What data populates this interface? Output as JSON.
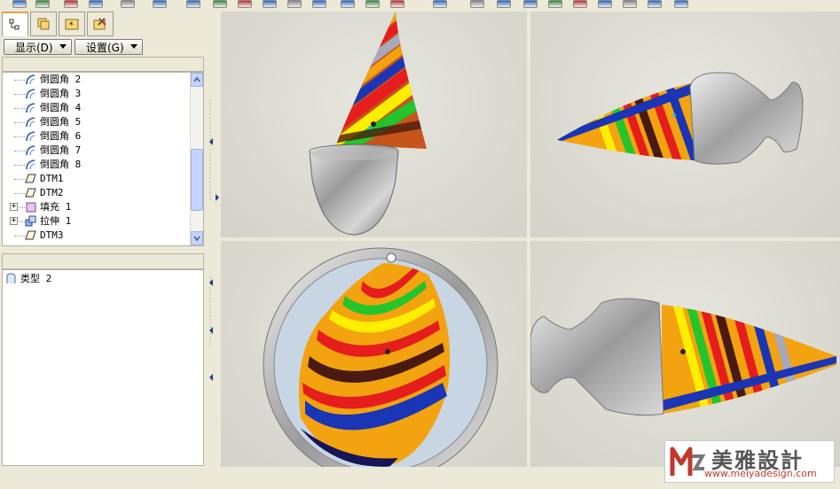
{
  "toolbar": {
    "icons": [
      "datum-display-icon",
      "axis-display-icon",
      "point-display-icon",
      "csys-display-icon",
      "layer-icon",
      "repaint-icon",
      "view-icon",
      "view-icon",
      "view-icon",
      "view-icon",
      "view-icon",
      "view-icon",
      "regen-icon",
      "delete-icon",
      "delete-icon",
      "check-icon",
      "check-icon",
      "cube-icon",
      "window-icon",
      "view-icon",
      "view-icon",
      "view-icon",
      "view-icon",
      "view-icon",
      "view-icon"
    ]
  },
  "navigator": {
    "tabs": [
      {
        "name": "model-tree-tab",
        "icon": "tree-icon",
        "active": true
      },
      {
        "name": "folder-browser-tab",
        "icon": "folder-icon",
        "active": false
      },
      {
        "name": "favorites-tab",
        "icon": "favorites-icon",
        "active": false
      },
      {
        "name": "connections-tab",
        "icon": "tools-icon",
        "active": false
      }
    ],
    "display_label": "显示(D)",
    "settings_label": "设置(G)"
  },
  "model_tree": {
    "items": [
      {
        "label": "倒圆角 2",
        "icon": "round-icon",
        "expandable": false
      },
      {
        "label": "倒圆角 3",
        "icon": "round-icon",
        "expandable": false
      },
      {
        "label": "倒圆角 4",
        "icon": "round-icon",
        "expandable": false
      },
      {
        "label": "倒圆角 5",
        "icon": "round-icon",
        "expandable": false
      },
      {
        "label": "倒圆角 6",
        "icon": "round-icon",
        "expandable": false
      },
      {
        "label": "倒圆角 7",
        "icon": "round-icon",
        "expandable": false
      },
      {
        "label": "倒圆角 8",
        "icon": "round-icon",
        "expandable": false
      },
      {
        "label": "DTM1",
        "icon": "datum-plane-icon",
        "expandable": false
      },
      {
        "label": "DTM2",
        "icon": "datum-plane-icon",
        "expandable": false
      },
      {
        "label": "填充 1",
        "icon": "fill-icon",
        "expandable": true
      },
      {
        "label": "拉伸 1",
        "icon": "extrude-icon",
        "expandable": true
      },
      {
        "label": "DTM3",
        "icon": "datum-plane-icon",
        "expandable": false
      }
    ]
  },
  "layer_tree": {
    "items": [
      {
        "label": "类型 2",
        "icon": "layer-type-icon"
      }
    ]
  },
  "viewports": [
    {
      "name": "viewport-front"
    },
    {
      "name": "viewport-right"
    },
    {
      "name": "viewport-top"
    },
    {
      "name": "viewport-left"
    }
  ],
  "watermark": {
    "title": "美雅設計",
    "url": "www.meiyadesign.com"
  },
  "colors": {
    "accent": "#e8a23a",
    "scrollbar": "#c3d3fd",
    "watermark_red": "#c0392b"
  }
}
